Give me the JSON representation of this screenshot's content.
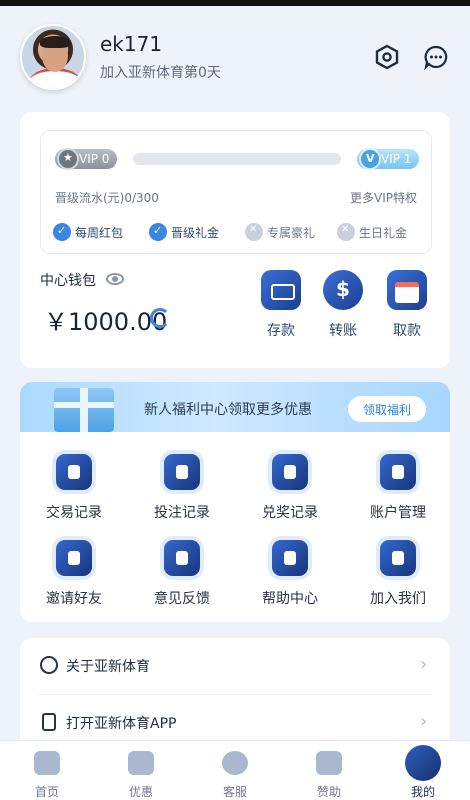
{
  "header": {
    "username": "ek171",
    "subtitle": "加入亚新体育第0天"
  },
  "vip": {
    "current_level": "VIP 0",
    "next_level": "VIP 1",
    "progress_fraction": 0,
    "turnover_text": "晋级流水(元)0/300",
    "more_privileges": "更多VIP特权",
    "perks": [
      {
        "label": "每周红包",
        "enabled": true
      },
      {
        "label": "晋级礼金",
        "enabled": true
      },
      {
        "label": "专属豪礼",
        "enabled": false
      },
      {
        "label": "生日礼金",
        "enabled": false
      }
    ]
  },
  "wallet": {
    "label": "中心钱包",
    "balance": "￥1000.00",
    "actions": [
      {
        "label": "存款",
        "icon": "wallet-icon"
      },
      {
        "label": "转账",
        "icon": "dollar-coin-icon"
      },
      {
        "label": "取款",
        "icon": "card-icon"
      }
    ]
  },
  "banner": {
    "text": "新人福利中心领取更多优惠",
    "button": "领取福利"
  },
  "grid": [
    {
      "label": "交易记录",
      "icon": "transaction-record-icon"
    },
    {
      "label": "投注记录",
      "icon": "bet-record-icon"
    },
    {
      "label": "兑奖记录",
      "icon": "prize-record-icon"
    },
    {
      "label": "账户管理",
      "icon": "account-manage-icon"
    },
    {
      "label": "邀请好友",
      "icon": "handshake-icon"
    },
    {
      "label": "意见反馈",
      "icon": "feedback-icon"
    },
    {
      "label": "帮助中心",
      "icon": "help-icon"
    },
    {
      "label": "加入我们",
      "icon": "join-icon"
    }
  ],
  "list": [
    {
      "label": "关于亚新体育",
      "icon": "info-icon"
    },
    {
      "label": "打开亚新体育APP",
      "icon": "phone-icon"
    }
  ],
  "tabs": [
    {
      "label": "首页",
      "icon": "home-icon"
    },
    {
      "label": "优惠",
      "icon": "ticket-icon"
    },
    {
      "label": "客服",
      "icon": "chat-icon"
    },
    {
      "label": "赞助",
      "icon": "crown-icon"
    },
    {
      "label": "我的",
      "icon": "profile-icon",
      "active": true
    }
  ]
}
